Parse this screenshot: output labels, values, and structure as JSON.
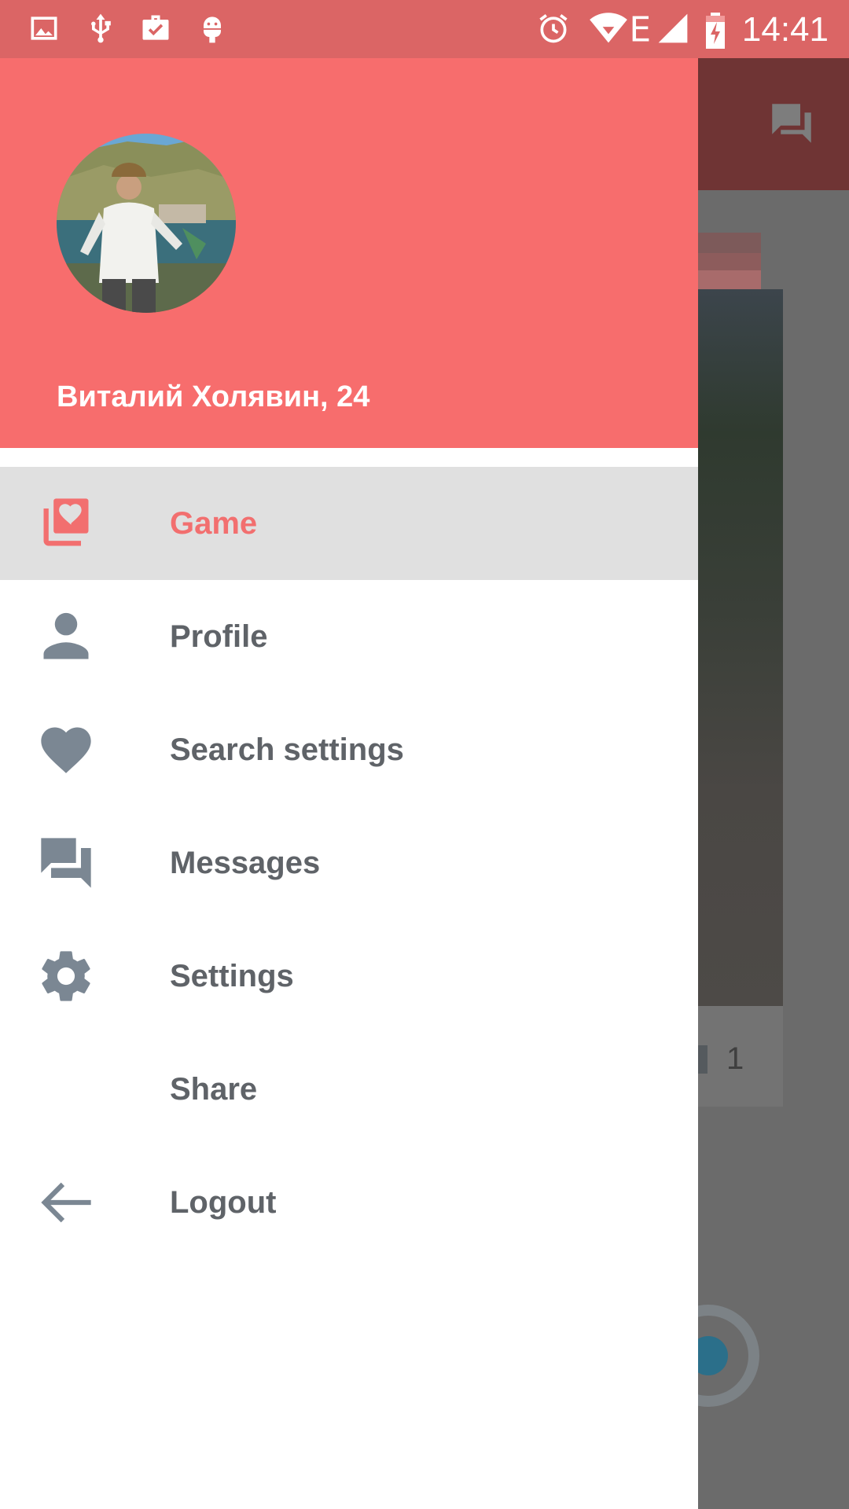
{
  "status_bar": {
    "time": "14:41",
    "icons": [
      "image-icon",
      "usb-icon",
      "briefcase-check-icon",
      "android-icon",
      "alarm-icon",
      "wifi-icon",
      "network-e-icon",
      "signal-icon",
      "battery-charging-icon"
    ],
    "network_type": "E"
  },
  "background_app": {
    "toolbar_icon": "chat-icon",
    "like_count": "1"
  },
  "drawer": {
    "header": {
      "user_name": "Виталий Холявин, 24",
      "avatar": "user-avatar-photo"
    },
    "items": [
      {
        "label": "Game",
        "icon": "cards-heart-icon",
        "selected": true
      },
      {
        "label": "Profile",
        "icon": "person-icon",
        "selected": false
      },
      {
        "label": "Search settings",
        "icon": "heart-icon",
        "selected": false
      },
      {
        "label": "Messages",
        "icon": "chat-icon",
        "selected": false
      },
      {
        "label": "Settings",
        "icon": "gear-icon",
        "selected": false
      },
      {
        "label": "Share",
        "icon": "",
        "selected": false
      },
      {
        "label": "Logout",
        "icon": "arrow-left-icon",
        "selected": false
      }
    ]
  },
  "colors": {
    "accent": "#f76d6d",
    "status_bar": "#db6565",
    "selected_text": "#f26f6f",
    "icon_gray": "#7b8793",
    "text_gray": "#5f6368",
    "selected_bg": "#e0e0e0"
  }
}
